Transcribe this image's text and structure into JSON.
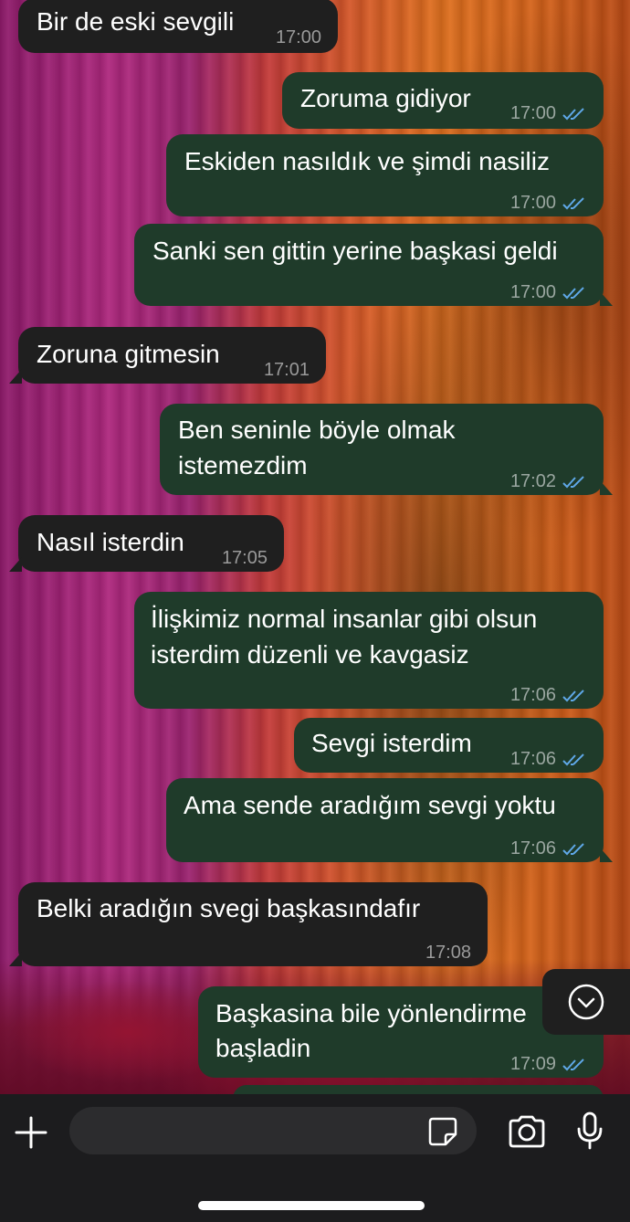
{
  "messages": [
    {
      "direction": "in",
      "lines": [
        "Bir de eski sevgili"
      ],
      "time": "17:00"
    },
    {
      "direction": "out",
      "lines": [
        "Zoruma gidiyor"
      ],
      "time": "17:00",
      "read": true
    },
    {
      "direction": "out",
      "lines": [
        "Eskiden nasıldık ve şimdi nasiliz"
      ],
      "time": "17:00",
      "read": true
    },
    {
      "direction": "out",
      "lines": [
        "Sanki sen gittin yerine başkasi geldi"
      ],
      "time": "17:00",
      "read": true
    },
    {
      "direction": "in",
      "lines": [
        "Zoruna gitmesin"
      ],
      "time": "17:01"
    },
    {
      "direction": "out",
      "lines": [
        "Ben seninle böyle olmak",
        "istemezdim"
      ],
      "time": "17:02",
      "read": true
    },
    {
      "direction": "in",
      "lines": [
        "Nasıl isterdin"
      ],
      "time": "17:05"
    },
    {
      "direction": "out",
      "lines": [
        "İlişkimiz normal insanlar gibi olsun",
        "isterdim düzenli ve kavgasiz"
      ],
      "time": "17:06",
      "read": true
    },
    {
      "direction": "out",
      "lines": [
        "Sevgi isterdim"
      ],
      "time": "17:06",
      "read": true
    },
    {
      "direction": "out",
      "lines": [
        "Ama sende aradığım sevgi yoktu"
      ],
      "time": "17:06",
      "read": true
    },
    {
      "direction": "in",
      "lines": [
        "Belki aradığın svegi başkasındafır"
      ],
      "time": "17:08"
    },
    {
      "direction": "out",
      "lines": [
        "Başkasina bile yönlendirme",
        "başladin"
      ],
      "time": "17:09",
      "read": true
    }
  ],
  "composer": {
    "input_placeholder": "",
    "add_icon": "plus-icon",
    "sticker_icon": "sticker-icon",
    "camera_icon": "camera-icon",
    "mic_icon": "microphone-icon"
  },
  "scroll_button_icon": "chevron-down-circle-icon",
  "colors": {
    "incoming_bubble": "#1f1f1f",
    "outgoing_bubble": "#1f3b2a",
    "read_ticks": "#5fa8e8",
    "timestamp": "#9aa6a0",
    "bar_background": "#1c1c1e"
  }
}
